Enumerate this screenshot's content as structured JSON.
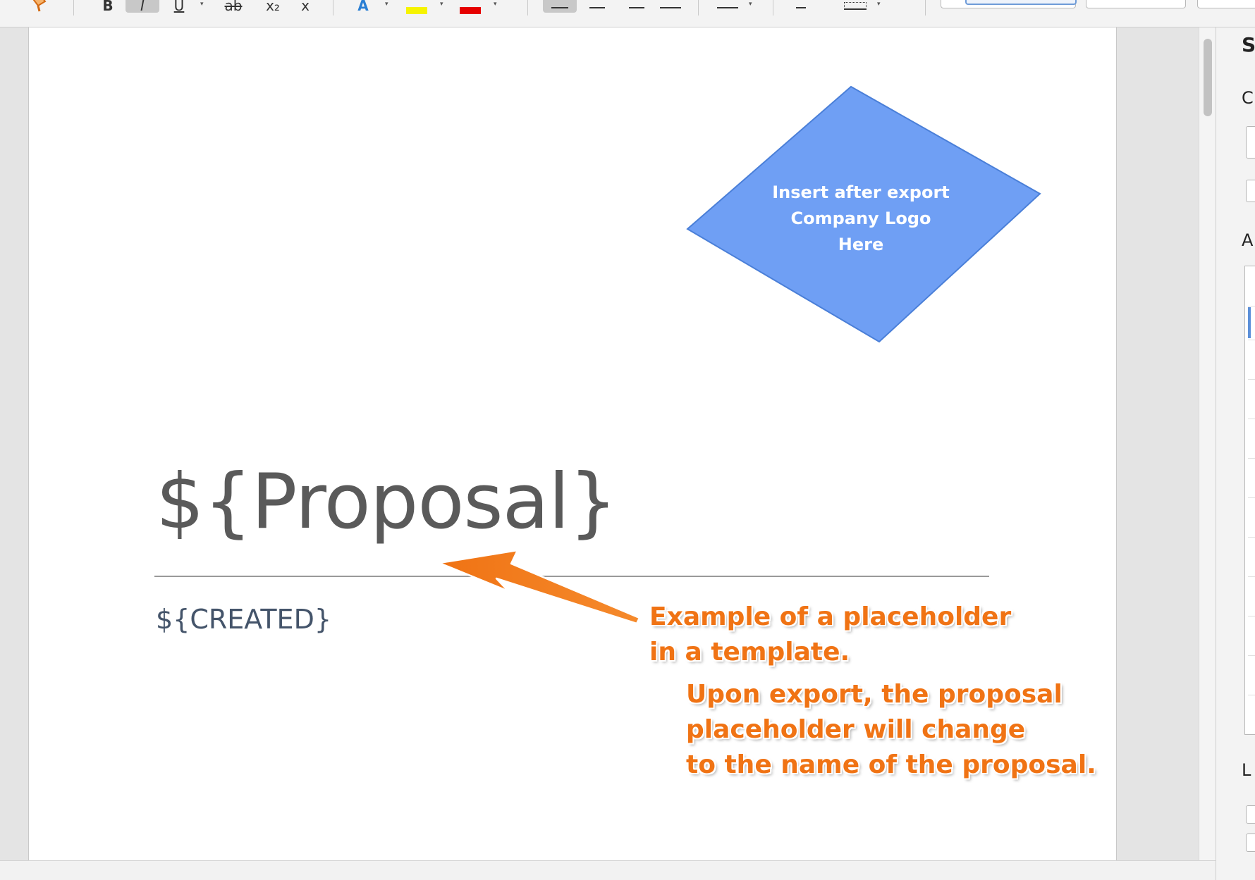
{
  "toolbar": {
    "bold_label": "B",
    "italic_label": "I",
    "underline_label": "U",
    "strikethrough_label": "ab",
    "subscript_label": "x₂",
    "superscript_label": "x",
    "text_effects_label": "A",
    "highlight_label": "A",
    "font_color_label": "A",
    "dropdown_glyph": "▾",
    "colors": {
      "highlight": "#f6f300",
      "font_color": "#e60000",
      "text_effects": "#2a7fd4"
    }
  },
  "document": {
    "logo_placeholder": {
      "line1": "Insert after export",
      "line2": "Company Logo",
      "line3": "Here",
      "fill_color": "#6f9ff4",
      "stroke_color": "#4a7fd8"
    },
    "title": "${Proposal}",
    "created": "${CREATED}"
  },
  "annotations": {
    "callout_1_line1": "Example of a placeholder",
    "callout_1_line2": "in a template.",
    "callout_2_line1": "Upon export, the proposal",
    "callout_2_line2": "placeholder will change",
    "callout_2_line3": "to the name of the proposal.",
    "arrow_color": "#f07314"
  },
  "sidebar": {
    "letter_1": "S",
    "letter_2": "C",
    "letter_3": "A",
    "letter_4": "L"
  }
}
